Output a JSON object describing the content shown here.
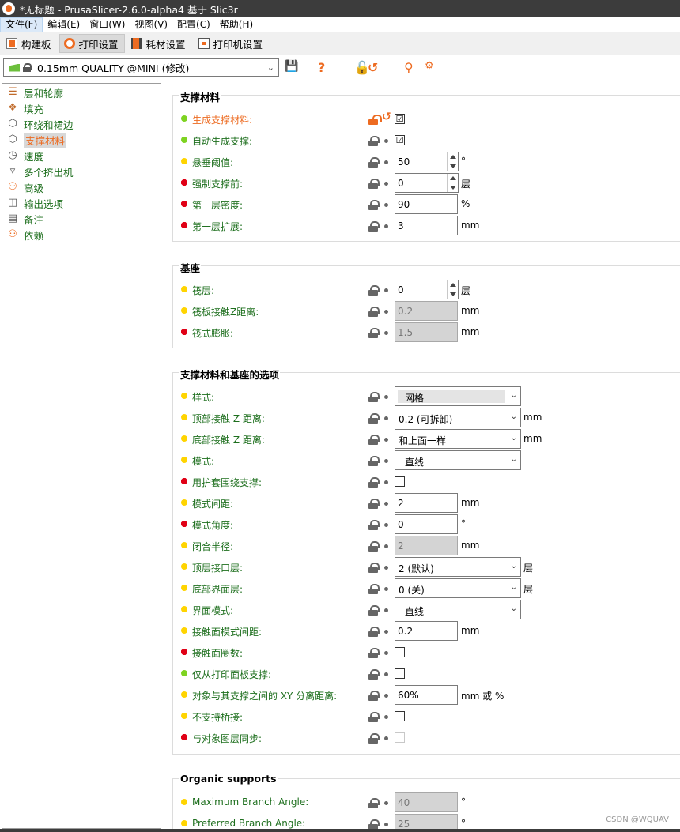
{
  "window": {
    "title": "*无标题 - PrusaSlicer-2.6.0-alpha4 基于 Slic3r"
  },
  "menu": [
    "文件(F)",
    "编辑(E)",
    "窗口(W)",
    "视图(V)",
    "配置(C)",
    "帮助(H)"
  ],
  "tabs": [
    {
      "label": "构建板",
      "icon": "plater-icon"
    },
    {
      "label": "打印设置",
      "icon": "print-settings-icon"
    },
    {
      "label": "耗材设置",
      "icon": "filament-icon"
    },
    {
      "label": "打印机设置",
      "icon": "printer-icon"
    }
  ],
  "preset": {
    "value": "0.15mm QUALITY @MINI (修改)"
  },
  "toolbar_icons": [
    "save-icon",
    "help-icon",
    "unlock-icon",
    "undo-icon",
    "search-icon",
    "compare-icon"
  ],
  "sidebar": [
    {
      "label": "层和轮廓",
      "icon": "layers-icon"
    },
    {
      "label": "填充",
      "icon": "infill-icon"
    },
    {
      "label": "环绕和裙边",
      "icon": "skirt-brim-icon"
    },
    {
      "label": "支撑材料",
      "icon": "support-icon"
    },
    {
      "label": "速度",
      "icon": "speed-icon"
    },
    {
      "label": "多个挤出机",
      "icon": "extruders-icon"
    },
    {
      "label": "高级",
      "icon": "advanced-icon"
    },
    {
      "label": "输出选项",
      "icon": "output-icon"
    },
    {
      "label": "备注",
      "icon": "notes-icon"
    },
    {
      "label": "依赖",
      "icon": "dependencies-icon"
    }
  ],
  "groups": {
    "support": {
      "title": "支撑材料",
      "rows": [
        {
          "label": "生成支撑材料:",
          "value": "☑"
        },
        {
          "label": "自动生成支撑:",
          "value": "☑"
        },
        {
          "label": "悬垂阈值:",
          "value": "50",
          "unit": "°"
        },
        {
          "label": "强制支撑前:",
          "value": "0",
          "unit": "层"
        },
        {
          "label": "第一层密度:",
          "value": "90",
          "unit": "%"
        },
        {
          "label": "第一层扩展:",
          "value": "3",
          "unit": "mm"
        }
      ]
    },
    "raft": {
      "title": "基座",
      "rows": [
        {
          "label": "筏层:",
          "value": "0",
          "unit": "层"
        },
        {
          "label": "筏板接触Z距离:",
          "value": "0.2",
          "unit": "mm"
        },
        {
          "label": "筏式膨胀:",
          "value": "1.5",
          "unit": "mm"
        }
      ]
    },
    "options": {
      "title": "支撑材料和基座的选项",
      "rows": [
        {
          "label": "样式:",
          "value": "网格"
        },
        {
          "label": "顶部接触 Z 距离:",
          "value": "0.2 (可拆卸)",
          "unit": "mm"
        },
        {
          "label": "底部接触 Z 距离:",
          "value": "和上面一样",
          "unit": "mm"
        },
        {
          "label": "模式:",
          "value": "直线"
        },
        {
          "label": "用护套围绕支撑:",
          "value": ""
        },
        {
          "label": "模式间距:",
          "value": "2",
          "unit": "mm"
        },
        {
          "label": "模式角度:",
          "value": "0",
          "unit": "°"
        },
        {
          "label": "闭合半径:",
          "value": "2",
          "unit": "mm"
        },
        {
          "label": "顶层接口层:",
          "value": "2 (默认)",
          "unit": "层"
        },
        {
          "label": "底部界面层:",
          "value": "0 (关)",
          "unit": "层"
        },
        {
          "label": "界面模式:",
          "value": "直线"
        },
        {
          "label": "接触面模式间距:",
          "value": "0.2",
          "unit": "mm"
        },
        {
          "label": "接触面圈数:",
          "value": ""
        },
        {
          "label": "仅从打印面板支撑:",
          "value": ""
        },
        {
          "label": "对象与其支撑之间的 XY 分离距离:",
          "value": "60%",
          "unit": "mm 或 %"
        },
        {
          "label": "不支持桥接:",
          "value": ""
        },
        {
          "label": "与对象图层同步:",
          "value": ""
        }
      ]
    },
    "organic": {
      "title": "Organic supports",
      "rows": [
        {
          "label": "Maximum Branch Angle:",
          "value": "40",
          "unit": "°"
        },
        {
          "label": "Preferred Branch Angle:",
          "value": "25",
          "unit": "°"
        }
      ]
    }
  },
  "watermark": "CSDN @WQUAV",
  "colors": {
    "accent": "#ed6b21",
    "label_green": "#1e6f1e",
    "bullet_green": "#7ed321",
    "bullet_yellow": "#ffd400",
    "bullet_red": "#e00016"
  }
}
